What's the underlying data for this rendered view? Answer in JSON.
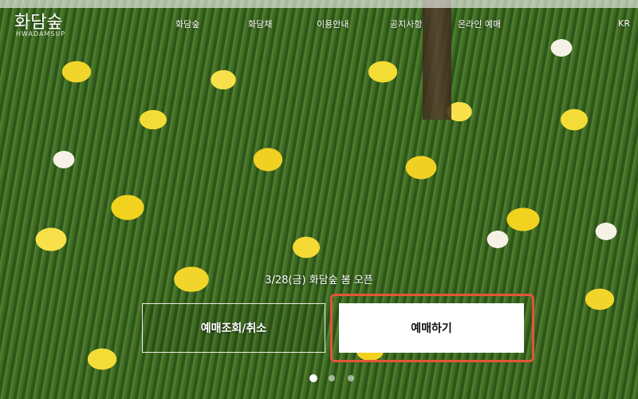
{
  "header": {
    "logo": "화담숲",
    "logo_sub": "HWADAMSUP",
    "nav": [
      {
        "label": "화담숲"
      },
      {
        "label": "화담채"
      },
      {
        "label": "이용안내"
      },
      {
        "label": "공지사항"
      },
      {
        "label": "온라인 예매"
      }
    ],
    "language": "KR"
  },
  "hero": {
    "subtitle": "3/28(금) 화담숲 봄 오픈",
    "buttons": {
      "lookup_cancel": "예매조회/취소",
      "book": "예매하기"
    },
    "slides": {
      "count": 3,
      "active_index": 0
    }
  },
  "colors": {
    "highlight": "#e5533a",
    "primary_button_bg": "#ffffff"
  }
}
